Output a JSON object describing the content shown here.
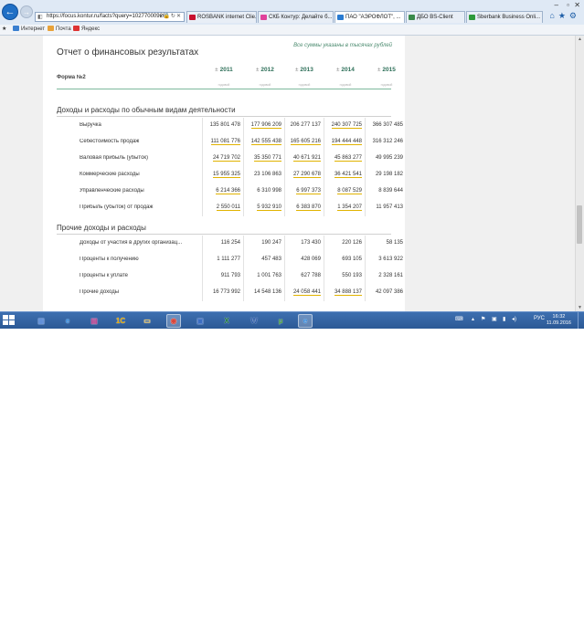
{
  "browser": {
    "address": "https://focus.kontur.ru/facts?query=102770009266",
    "tabs": [
      {
        "label": "ROSBANK internet Clie...",
        "color": "#c8102e"
      },
      {
        "label": "СКБ Контур: Делайте б...",
        "color": "#e0409a"
      },
      {
        "label": "ПАО \"АЭРОФЛОТ\", ...",
        "color": "#2a7bd1"
      },
      {
        "label": "ДБО BS-Client",
        "color": "#3a8a4a"
      },
      {
        "label": "Sberbank Business Onli...",
        "color": "#2e9a3a"
      }
    ],
    "favorites": [
      "Интернет",
      "Почта",
      "Яндекс"
    ]
  },
  "report": {
    "title": "Отчет о финансовых результатах",
    "note": "Все суммы указаны в тысячах рублей",
    "form_label": "Форма №2",
    "years": [
      "2011",
      "2012",
      "2013",
      "2014",
      "2015"
    ],
    "year_sub": [
      "годовой",
      "годовой",
      "годовой",
      "годовой",
      "годовой"
    ],
    "sections": [
      {
        "title": "Доходы и расходы по обычным видам деятельности",
        "rows": [
          {
            "label": "Выручка",
            "values": [
              "135 801 478",
              "177 906 209",
              "206 277 137",
              "240 307 725",
              "366 307 485"
            ],
            "links": [
              false,
              true,
              false,
              true,
              false
            ]
          },
          {
            "label": "Себестоимость продаж",
            "values": [
              "111 081 776",
              "142 555 438",
              "165 605 216",
              "194 444 448",
              "316 312 246"
            ],
            "links": [
              true,
              true,
              true,
              true,
              false
            ]
          },
          {
            "label": "Валовая прибыль (убыток)",
            "values": [
              "24 719 702",
              "35 350 771",
              "40 671 921",
              "45 863 277",
              "49 995 239"
            ],
            "links": [
              true,
              true,
              true,
              true,
              false
            ]
          },
          {
            "label": "Коммерческие расходы",
            "values": [
              "15 955 325",
              "23 106 863",
              "27 290 678",
              "36 421 541",
              "29 198 182"
            ],
            "links": [
              true,
              false,
              true,
              true,
              false
            ]
          },
          {
            "label": "Управленческие расходы",
            "values": [
              "6 214 366",
              "6 310 998",
              "6 997 373",
              "8 087 529",
              "8 839 644"
            ],
            "links": [
              true,
              false,
              true,
              true,
              false
            ]
          },
          {
            "label": "Прибыль (убыток) от продаж",
            "values": [
              "2 550 011",
              "5 932 910",
              "6 383 870",
              "1 354 207",
              "11 957 413"
            ],
            "links": [
              true,
              true,
              true,
              true,
              false
            ]
          }
        ]
      },
      {
        "title": "Прочие доходы и расходы",
        "rows": [
          {
            "label": "Доходы от участия в других организац...",
            "values": [
              "116 254",
              "190 247",
              "173 430",
              "220 126",
              "58 135"
            ],
            "links": [
              false,
              false,
              false,
              false,
              false
            ]
          },
          {
            "label": "Проценты к получению",
            "values": [
              "1 111 277",
              "457 483",
              "428 069",
              "693 105",
              "3 613 922"
            ],
            "links": [
              false,
              false,
              false,
              false,
              false
            ]
          },
          {
            "label": "Проценты к уплате",
            "values": [
              "911 793",
              "1 001 763",
              "627 788",
              "550 193",
              "2 328 161"
            ],
            "links": [
              false,
              false,
              false,
              false,
              false
            ]
          },
          {
            "label": "Прочие доходы",
            "values": [
              "16 773 992",
              "14 548 136",
              "24 058 441",
              "34 888 137",
              "42 097 386"
            ],
            "links": [
              false,
              false,
              true,
              true,
              false
            ]
          }
        ]
      }
    ]
  },
  "taskbar": {
    "language": "РУС",
    "time": "16:32",
    "date": "11.09.2016",
    "apps": [
      {
        "name": "network-app-icon",
        "glyph": "▦",
        "color": "#5b8bd6"
      },
      {
        "name": "internet-explorer-icon",
        "glyph": "e",
        "color": "#2f8ae0"
      },
      {
        "name": "winrar-icon",
        "glyph": "▤",
        "color": "#b7388a"
      },
      {
        "name": "1c-icon",
        "glyph": "1С",
        "color": "#e5a800"
      },
      {
        "name": "file-explorer-icon",
        "glyph": "▭",
        "color": "#e8c15a"
      },
      {
        "name": "chrome-icon",
        "glyph": "◉",
        "color": "#d9453a"
      },
      {
        "name": "remote-desktop-icon",
        "glyph": "▣",
        "color": "#3c6ec2"
      },
      {
        "name": "excel-icon",
        "glyph": "X",
        "color": "#1e7a3c"
      },
      {
        "name": "word-icon",
        "glyph": "W",
        "color": "#2b5aa8"
      },
      {
        "name": "utorrent-icon",
        "glyph": "µ",
        "color": "#4aa03a"
      },
      {
        "name": "internet-explorer-active-icon",
        "glyph": "e",
        "color": "#2f8ae0"
      }
    ]
  }
}
